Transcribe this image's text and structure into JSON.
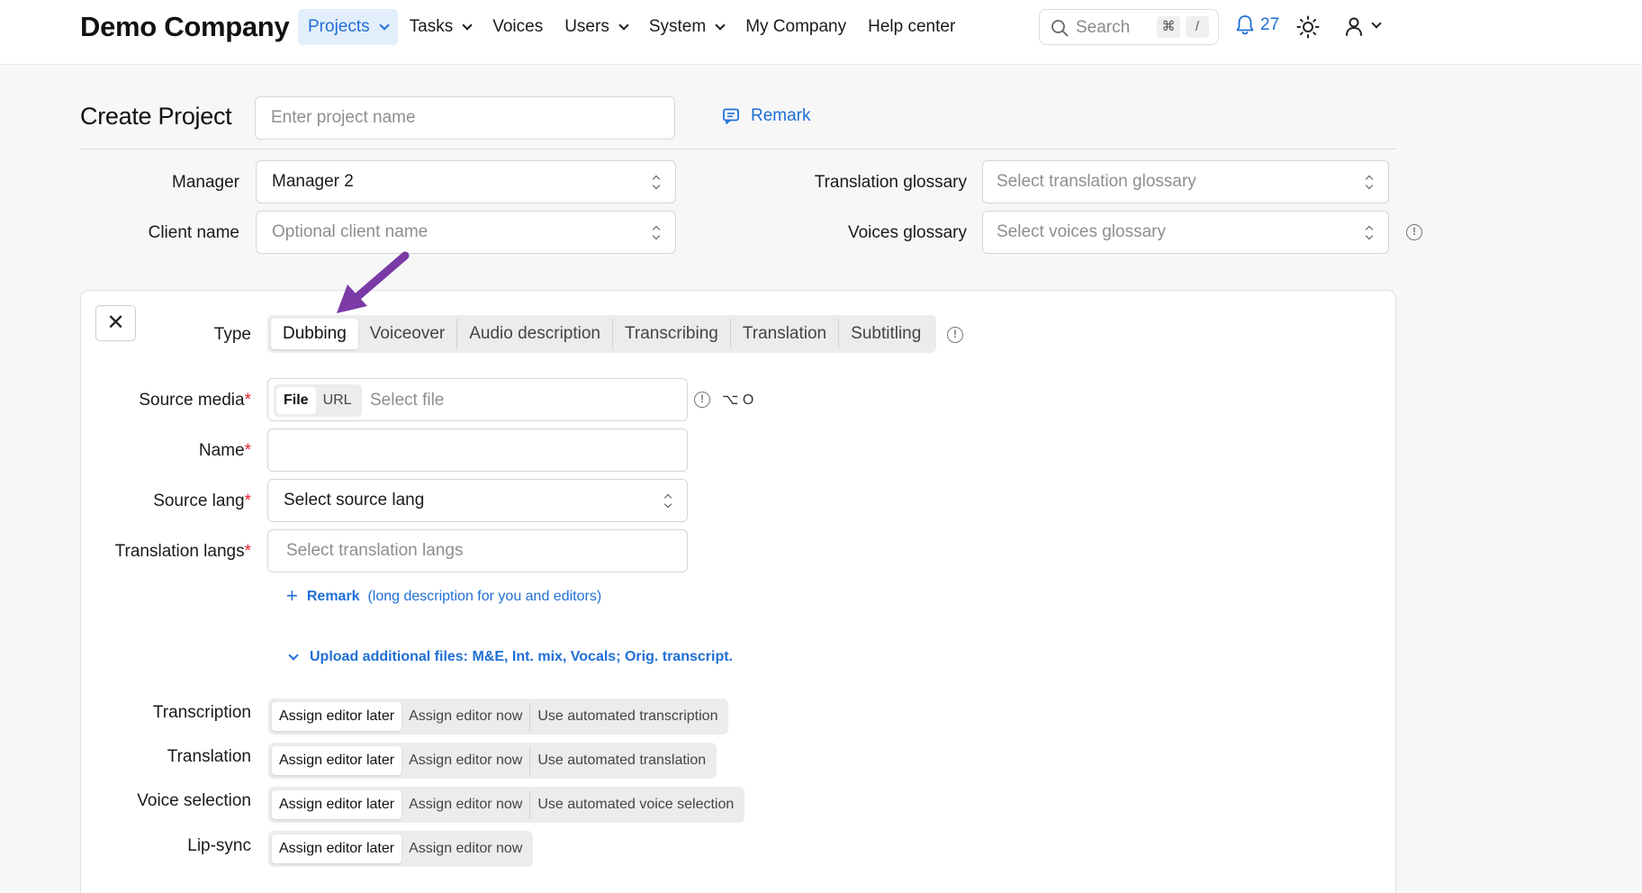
{
  "header": {
    "brand": "Demo Company",
    "nav": [
      {
        "label": "Projects",
        "active": true,
        "dropdown": true
      },
      {
        "label": "Tasks",
        "dropdown": true
      },
      {
        "label": "Voices",
        "dropdown": false
      },
      {
        "label": "Users",
        "dropdown": true
      },
      {
        "label": "System",
        "dropdown": true
      },
      {
        "label": "My Company",
        "dropdown": false
      },
      {
        "label": "Help center",
        "dropdown": false
      }
    ],
    "search_placeholder": "Search",
    "search_kbd_1": "⌘",
    "search_kbd_2": "/",
    "notifications_count": "27",
    "accent_color": "#1f6fd6"
  },
  "title_row": {
    "title": "Create Project",
    "project_name_placeholder": "Enter project name",
    "remark_label": "Remark"
  },
  "meta": {
    "manager_label": "Manager",
    "manager_value": "Manager 2",
    "client_label": "Client name",
    "client_placeholder": "Optional client name",
    "translation_glossary_label": "Translation glossary",
    "translation_glossary_placeholder": "Select translation glossary",
    "voices_glossary_label": "Voices glossary",
    "voices_glossary_placeholder": "Select voices glossary"
  },
  "card": {
    "close": "✕",
    "type_label": "Type",
    "types": [
      "Dubbing",
      "Voiceover",
      "Audio description",
      "Transcribing",
      "Translation",
      "Subtitling"
    ],
    "selected_type": "Dubbing",
    "source_media_label": "Source media",
    "media_file": "File",
    "media_url": "URL",
    "media_placeholder": "Select file",
    "media_shortcut": "⌥ O",
    "name_label": "Name",
    "source_lang_label": "Source lang",
    "source_lang_value": "Select source lang",
    "translation_langs_label": "Translation langs",
    "translation_langs_placeholder": "Select translation langs",
    "remark_link": "Remark",
    "remark_hint": "(long description for you and editors)",
    "upload_link": "Upload additional files: M&E, Int. mix, Vocals; Orig. transcript.",
    "required_mark": "*",
    "steps": [
      {
        "label": "Transcription",
        "options": [
          "Assign editor later",
          "Assign editor now",
          "Use automated transcription"
        ]
      },
      {
        "label": "Translation",
        "options": [
          "Assign editor later",
          "Assign editor now",
          "Use automated translation"
        ]
      },
      {
        "label": "Voice selection",
        "options": [
          "Assign editor later",
          "Assign editor now",
          "Use automated voice selection"
        ]
      },
      {
        "label": "Lip-sync",
        "options": [
          "Assign editor later",
          "Assign editor now"
        ]
      }
    ]
  },
  "annotation_arrow_color": "#7b3aa6"
}
